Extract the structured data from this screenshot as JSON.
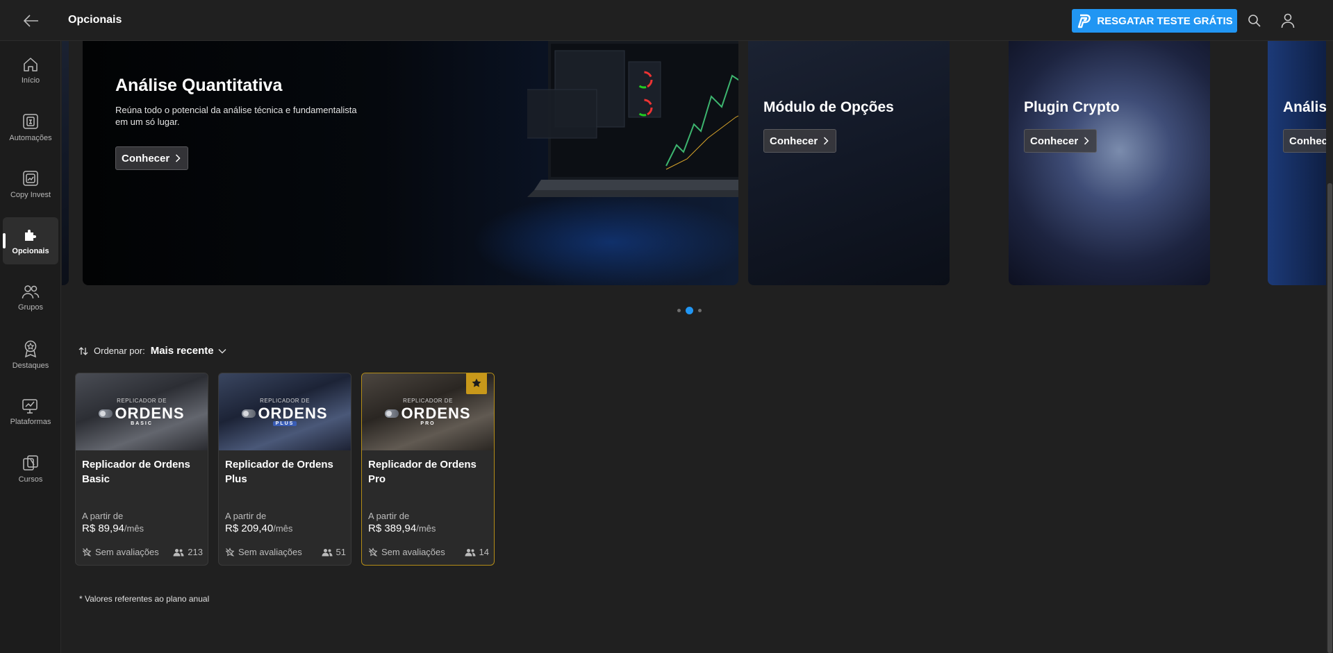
{
  "header": {
    "title": "Opcionais",
    "trial_label": "RESGATAR TESTE GRÁTIS",
    "back_icon": "arrow-left-icon",
    "search_icon": "search-icon",
    "user_icon": "user-icon"
  },
  "sidebar": {
    "items": [
      {
        "label": "Início",
        "icon": "home-icon"
      },
      {
        "label": "Automações",
        "icon": "automation-icon"
      },
      {
        "label": "Copy Invest",
        "icon": "copy-invest-icon"
      },
      {
        "label": "Opcionais",
        "icon": "puzzle-icon",
        "active": true
      },
      {
        "label": "Grupos",
        "icon": "users-icon"
      },
      {
        "label": "Destaques",
        "icon": "award-icon"
      },
      {
        "label": "Plataformas",
        "icon": "monitor-icon"
      },
      {
        "label": "Cursos",
        "icon": "courses-icon"
      }
    ]
  },
  "carousel": {
    "slides": [
      {
        "title": "Análise Quantitativa",
        "subtitle_line1": "Reúna todo o potencial da análise técnica e fundamentalista",
        "subtitle_line2": "em um só lugar.",
        "button": "Conhecer"
      },
      {
        "title": "Módulo de Opções",
        "button": "Conhecer"
      },
      {
        "title": "Plugin Crypto",
        "button": "Conhecer"
      },
      {
        "title": "Anális",
        "button": "Conhec"
      }
    ],
    "active_index": 1,
    "dot_count": 3
  },
  "sort": {
    "label": "Ordenar por:",
    "value": "Mais recente"
  },
  "products": [
    {
      "logo_small": "REPLICADOR DE",
      "logo_big": "ORDENS",
      "tier": "BASIC",
      "title": "Replicador de Ordens Basic",
      "from": "A partir de",
      "price": "R$ 89,94",
      "per": "/mês",
      "rating": "Sem avaliações",
      "users": "213",
      "featured": false
    },
    {
      "logo_small": "REPLICADOR DE",
      "logo_big": "ORDENS",
      "tier": "PLUS",
      "title": "Replicador de Ordens Plus",
      "from": "A partir de",
      "price": "R$ 209,40",
      "per": "/mês",
      "rating": "Sem avaliações",
      "users": "51",
      "featured": false
    },
    {
      "logo_small": "REPLICADOR DE",
      "logo_big": "ORDENS",
      "tier": "PRO",
      "title": "Replicador de Ordens Pro",
      "from": "A partir de",
      "price": "R$ 389,94",
      "per": "/mês",
      "rating": "Sem avaliações",
      "users": "14",
      "featured": true
    }
  ],
  "footnote": "* Valores referentes ao plano anual",
  "colors": {
    "accent": "#2196f3",
    "featured": "#c8981a",
    "background": "#202020"
  }
}
